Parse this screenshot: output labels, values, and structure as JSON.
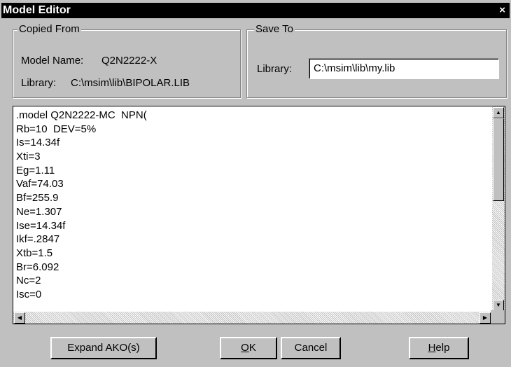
{
  "window": {
    "title": "Model Editor",
    "close_glyph": "×"
  },
  "copied_from": {
    "legend": "Copied From",
    "model_name_label": "Model Name:",
    "model_name_value": "Q2N2222-X",
    "library_label": "Library:",
    "library_value": "C:\\msim\\lib\\BIPOLAR.LIB"
  },
  "save_to": {
    "legend": "Save To",
    "library_label": "Library:",
    "library_value": "C:\\msim\\lib\\my.lib"
  },
  "editor": {
    "lines": [
      ".model Q2N2222-MC  NPN(",
      "Rb=10  DEV=5%",
      "Is=14.34f",
      "Xti=3",
      "Eg=1.11",
      "Vaf=74.03",
      "Bf=255.9",
      "Ne=1.307",
      "Ise=14.34f",
      "Ikf=.2847",
      "Xtb=1.5",
      "Br=6.092",
      "Nc=2",
      "Isc=0"
    ]
  },
  "buttons": {
    "expand": "Expand AKO(s)",
    "ok_mnemonic": "O",
    "ok_rest": "K",
    "cancel": "Cancel",
    "help_mnemonic": "H",
    "help_rest": "elp"
  }
}
